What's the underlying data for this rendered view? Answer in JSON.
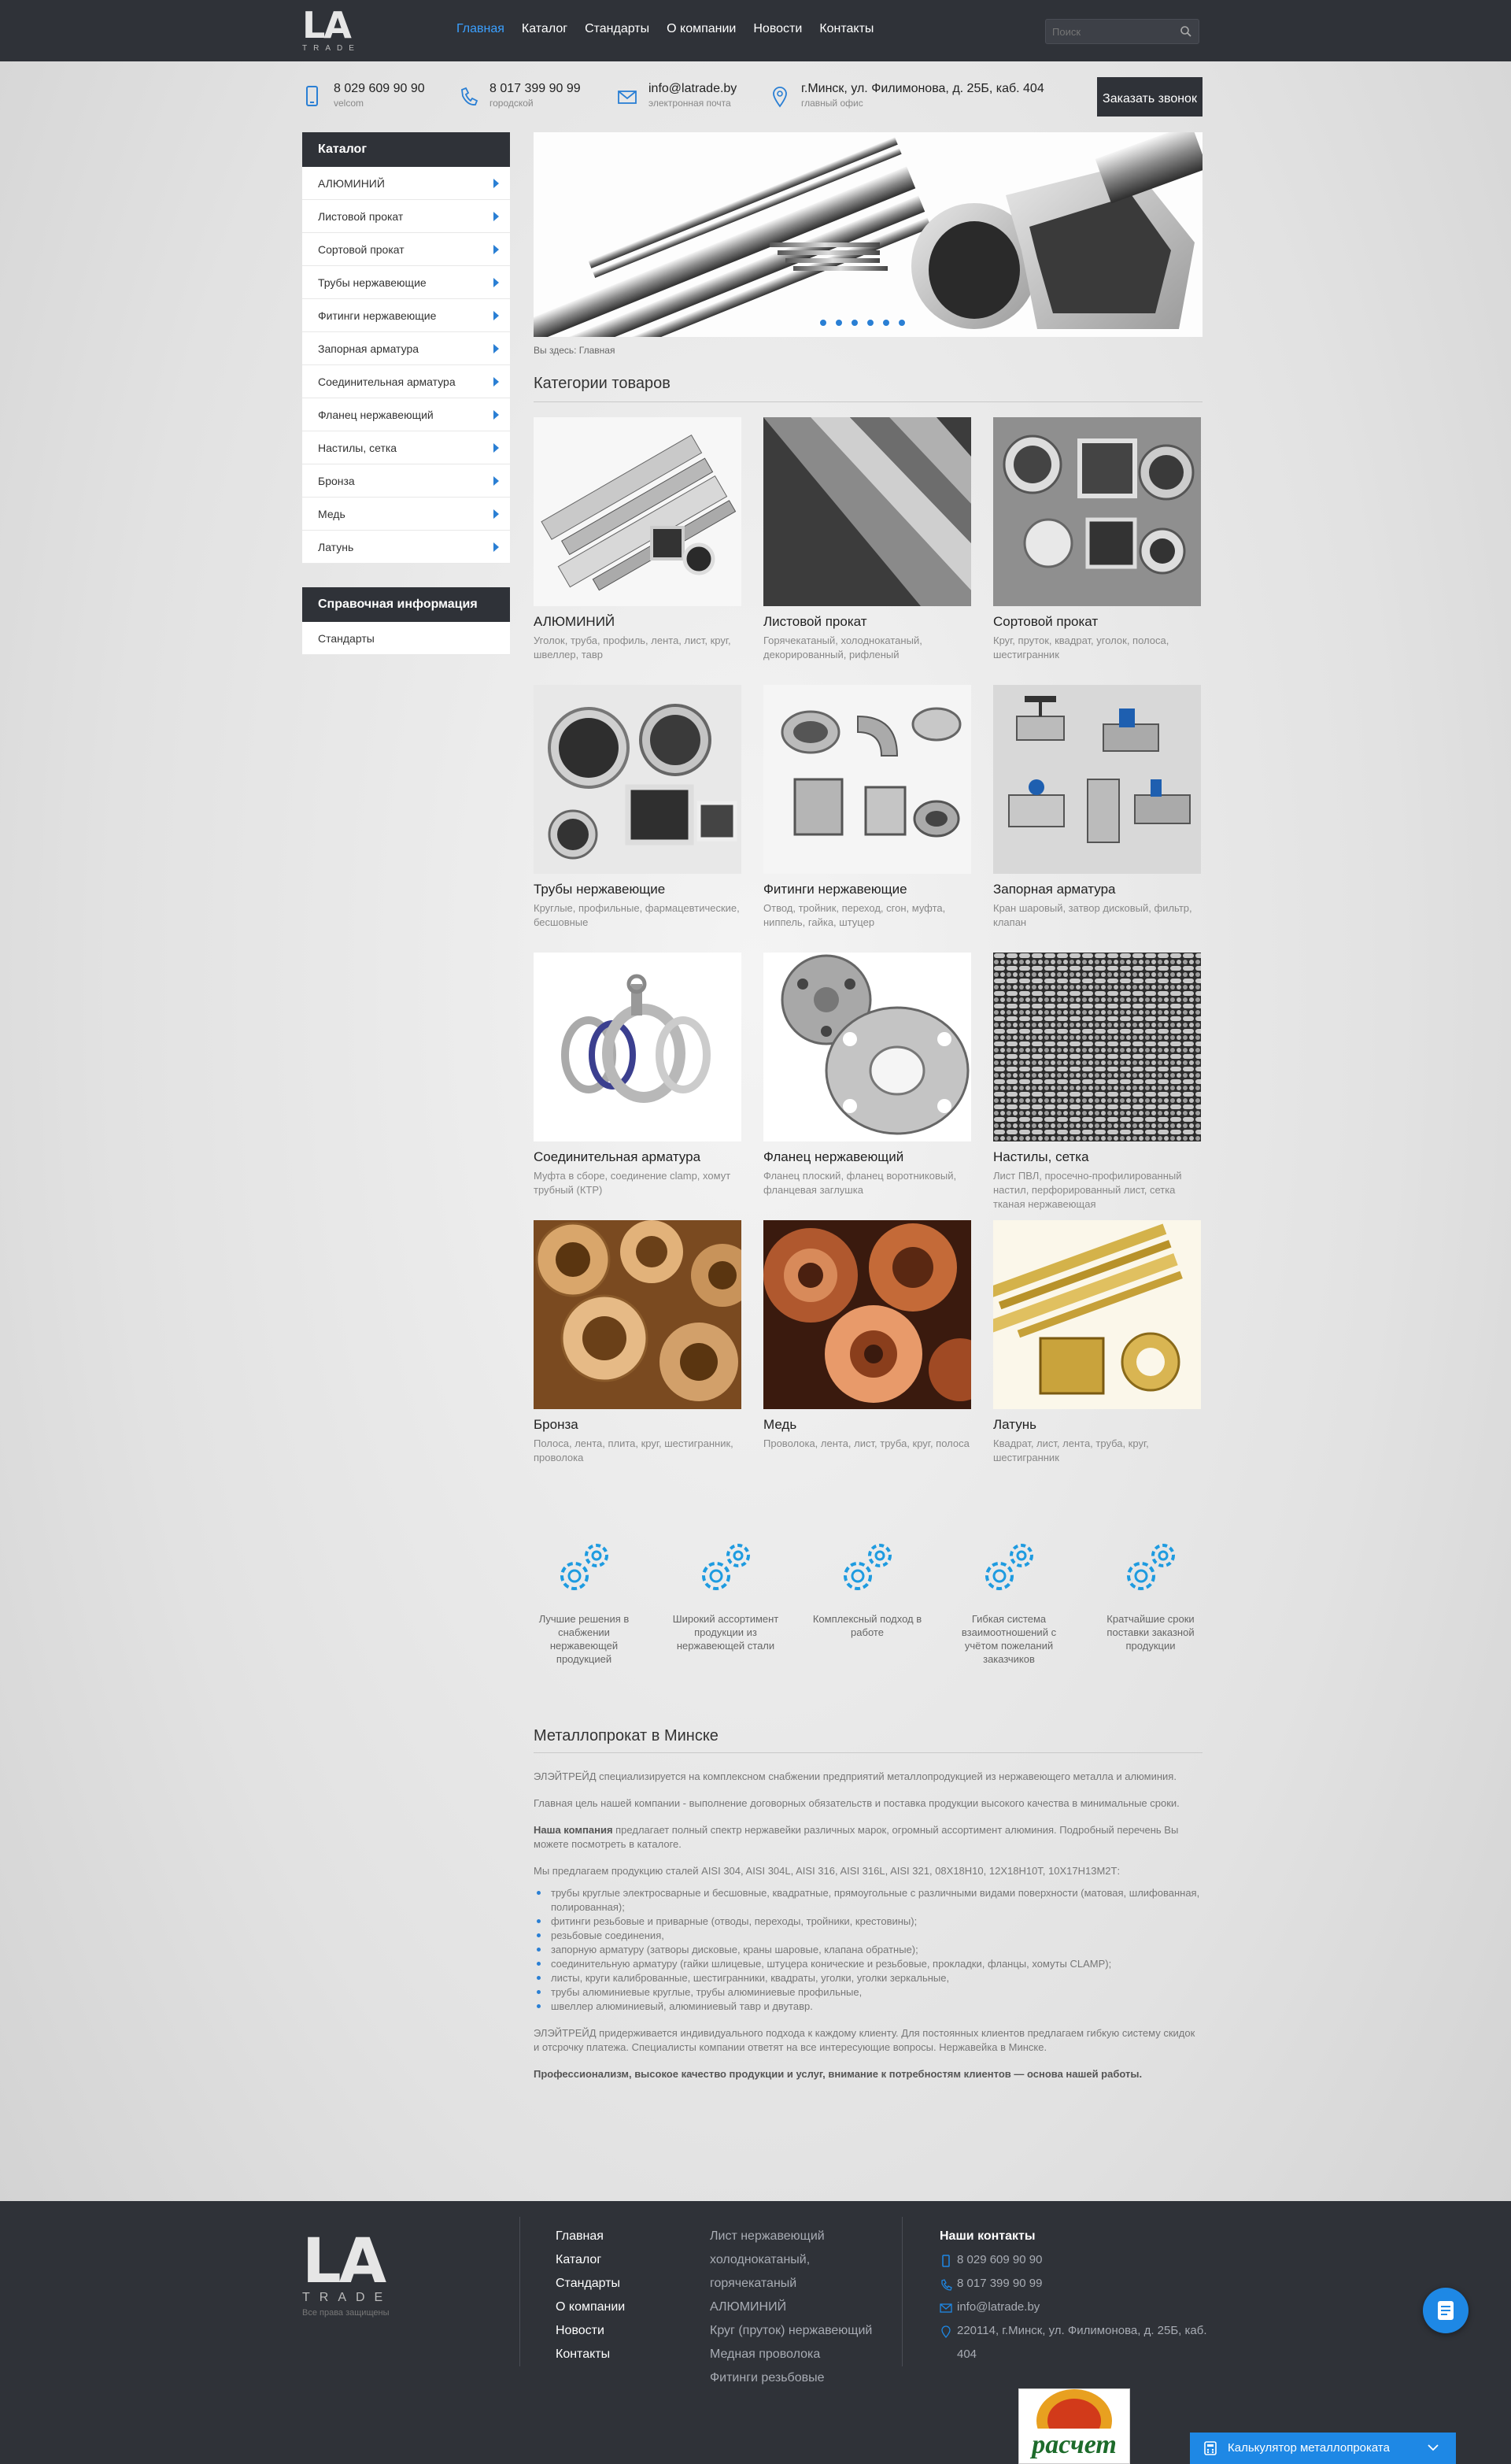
{
  "header": {
    "logo_text": "LA",
    "logo_sub": "TRADE",
    "nav": [
      {
        "label": "Главная",
        "active": true
      },
      {
        "label": "Каталог",
        "active": false
      },
      {
        "label": "Стандарты",
        "active": false
      },
      {
        "label": "О компании",
        "active": false
      },
      {
        "label": "Новости",
        "active": false
      },
      {
        "label": "Контакты",
        "active": false
      }
    ],
    "search_placeholder": "Поиск"
  },
  "contacts": {
    "phone1": {
      "main": "8 029 609 90 90",
      "sub": "velcom"
    },
    "phone2": {
      "main": "8 017 399 90 99",
      "sub": "городской"
    },
    "email": {
      "main": "info@latrade.by",
      "sub": "электронная почта"
    },
    "address": {
      "main": "г.Минск, ул. Филимонова, д. 25Б, каб. 404",
      "sub": "главный офис"
    },
    "callback_label": "Заказать звонок"
  },
  "sidebar": {
    "catalog_title": "Каталог",
    "items": [
      "АЛЮМИНИЙ",
      "Листовой прокат",
      "Сортовой прокат",
      "Трубы нержавеющие",
      "Фитинги нержавеющие",
      "Запорная арматура",
      "Соединительная арматура",
      "Фланец нержавеющий",
      "Настилы, сетка",
      "Бронза",
      "Медь",
      "Латунь"
    ],
    "info_title": "Справочная информация",
    "info_items": [
      "Стандарты"
    ]
  },
  "slider": {
    "dots_count": 6
  },
  "breadcrumb": "Вы здесь: Главная",
  "categories_title": "Категории товаров",
  "products": [
    {
      "name": "АЛЮМИНИЙ",
      "desc": "Уголок, труба, профиль, лента, лист, круг, швеллер, тавр"
    },
    {
      "name": "Листовой прокат",
      "desc": "Горячекатаный, холоднокатаный, декорированный, рифленый"
    },
    {
      "name": "Сортовой прокат",
      "desc": "Круг, пруток, квадрат, уголок, полоса, шестигранник"
    },
    {
      "name": "Трубы нержавеющие",
      "desc": "Круглые, профильные, фармацевтические, бесшовные"
    },
    {
      "name": "Фитинги нержавеющие",
      "desc": "Отвод, тройник, переход, сгон, муфта, ниппель, гайка, штуцер"
    },
    {
      "name": "Запорная арматура",
      "desc": "Кран шаровый, затвор дисковый, фильтр, клапан"
    },
    {
      "name": "Соединительная арматура",
      "desc": "Муфта в сборе, соединение clamp, хомут трубный (КТР)"
    },
    {
      "name": "Фланец нержавеющий",
      "desc": "Фланец плоский, фланец воротниковый, фланцевая заглушка"
    },
    {
      "name": "Настилы, сетка",
      "desc": "Лист ПВЛ, просечно-профилированный настил, перфорированный лист, сетка тканая нержавеющая"
    },
    {
      "name": "Бронза",
      "desc": "Полоса, лента, плита, круг, шестигранник, проволока"
    },
    {
      "name": "Медь",
      "desc": "Проволока, лента, лист, труба, круг, полоса"
    },
    {
      "name": "Латунь",
      "desc": "Квадрат, лист, лента, труба, круг, шестигранник"
    }
  ],
  "features": [
    "Лучшие решения в снабжении нержавеющей продукцией",
    "Широкий ассортимент продукции из нержавеющей стали",
    "Комплексный подход в работе",
    "Гибкая система взаимоотношений с учётом пожеланий заказчиков",
    "Кратчайшие сроки поставки заказной продукции"
  ],
  "about": {
    "title": "Металлопрокат в Минске",
    "p1": "ЭЛЭЙТРЕЙД специализируется на комплексном снабжении предприятий металлопродукцией из нержавеющего металла и алюминия.",
    "p2": "Главная цель нашей компании - выполнение договорных обязательств и поставка продукции высокого качества в минимальные сроки.",
    "p3_bold": "Наша компания",
    "p3": " предлагает полный спектр нержавейки различных марок, огромный ассортимент алюминия. Подробный перечень Вы можете посмотреть в каталоге.",
    "p4": "Мы предлагаем продукцию сталей AISI 304, AISI 304L, AISI 316, AISI 316L, AISI 321, 08Х18Н10, 12Х18Н10Т, 10Х17Н13М2Т:",
    "list": [
      "трубы круглые электросварные и бесшовные, квадратные, прямоугольные с различными видами поверхности (матовая, шлифованная, полированная);",
      "фитинги резьбовые и приварные (отводы, переходы, тройники, крестовины);",
      "резьбовые соединения,",
      "запорную арматуру (затворы дисковые, краны шаровые, клапана обратные);",
      "соединительную арматуру (гайки шлицевые, штуцера конические и резьбовые, прокладки, фланцы, хомуты CLAMP);",
      "листы, круги калиброванные, шестигранники, квадраты, уголки, уголки зеркальные,",
      "трубы алюминиевые круглые, трубы алюминиевые профильные,",
      "швеллер алюминиевый, алюминиевый тавр и двутавр."
    ],
    "p5": "ЭЛЭЙТРЕЙД придерживается индивидуального подхода к каждому клиенту. Для постоянных клиентов предлагаем гибкую систему скидок и отсрочку платежа. Специалисты компании ответят на все интересующие вопросы. Нержавейка в Минске.",
    "p6": "Профессионализм, высокое качество продукции и услуг, внимание к потребностям клиентов — основа нашей работы."
  },
  "footer": {
    "logo_text": "LA",
    "logo_sub": "TRADE",
    "rights": "Все права защищены",
    "links": [
      "Главная",
      "Каталог",
      "Стандарты",
      "О компании",
      "Новости",
      "Контакты"
    ],
    "links2": [
      "Лист нержавеющий",
      "холоднокатаный,",
      "горячекатаный",
      "АЛЮМИНИЙ",
      "Круг (пруток) нержавеющий",
      "Медная проволока",
      "Фитинги резьбовые"
    ],
    "contacts_title": "Наши контакты",
    "phone1": "8 029 609 90 90",
    "phone2": "8 017 399 90 99",
    "email": "info@latrade.by",
    "address": "220114, г.Минск, ул. Филимонова, д. 25Б, каб. 404"
  },
  "widgets": {
    "calculator_label": "Калькулятор металлопроката",
    "raschet_label": "расчет"
  },
  "colors": {
    "accent": "#2a7fd4",
    "dark": "#2f3238",
    "active_nav": "#3ba0ff"
  }
}
